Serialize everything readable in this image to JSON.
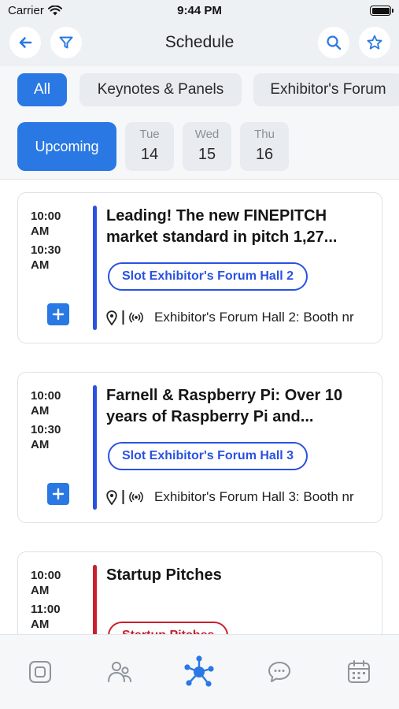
{
  "status_bar": {
    "carrier": "Carrier",
    "time": "9:44 PM"
  },
  "header": {
    "title": "Schedule"
  },
  "filters": [
    "All",
    "Keynotes & Panels",
    "Exhibitor's Forum"
  ],
  "dates": {
    "upcoming": "Upcoming",
    "days": [
      {
        "name": "Tue",
        "num": "14"
      },
      {
        "name": "Wed",
        "num": "15"
      },
      {
        "name": "Thu",
        "num": "16"
      }
    ]
  },
  "sessions": [
    {
      "start_time": "10:00 AM",
      "end_time": "10:30 AM",
      "title_line1": "Leading! The new FINEPITCH",
      "title_line2": "market standard in pitch 1,27...",
      "badge": "Slot Exhibitor's Forum Hall 2",
      "location": "Exhibitor's Forum Hall 2: Booth nr",
      "color": "#2a52e0"
    },
    {
      "start_time": "10:00 AM",
      "end_time": "10:30 AM",
      "title_line1": "Farnell & Raspberry Pi: Over 10",
      "title_line2": "years of Raspberry Pi and...",
      "badge": "Slot Exhibitor's Forum Hall 3",
      "location": "Exhibitor's Forum Hall 3: Booth nr",
      "color": "#2a52e0"
    },
    {
      "start_time": "10:00 AM",
      "end_time": "11:00 AM",
      "title_line1": "Startup Pitches",
      "title_line2": "",
      "badge": "Startup Pitches",
      "location": "",
      "color": "#c8202e"
    }
  ],
  "tab_bar": {
    "active": "network",
    "icons": [
      "dashboard-icon",
      "people-icon",
      "network-icon",
      "chat-icon",
      "calendar-icon"
    ],
    "active_color": "#2a78e4"
  }
}
